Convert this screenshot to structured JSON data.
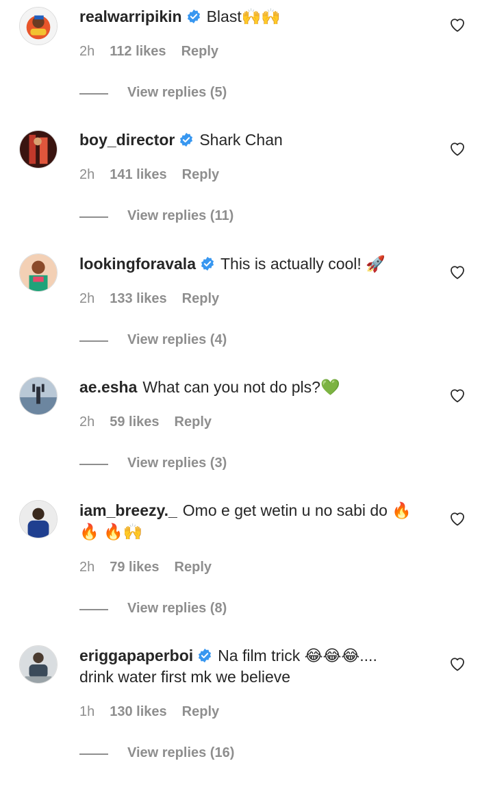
{
  "colors": {
    "verified": "#3897f0",
    "muted": "#8e8e8e",
    "text": "#262626"
  },
  "comments": [
    {
      "username": "realwarripikin",
      "verified": true,
      "text": "Blast🙌🙌",
      "continuation": "",
      "time": "2h",
      "likes": "112 likes",
      "reply": "Reply",
      "view_replies": "View replies (5)",
      "avatar_icon": "avatar-icon"
    },
    {
      "username": "boy_director",
      "verified": true,
      "text": "Shark Chan",
      "continuation": "",
      "time": "2h",
      "likes": "141 likes",
      "reply": "Reply",
      "view_replies": "View replies (11)",
      "avatar_icon": "avatar-icon"
    },
    {
      "username": "lookingforavala",
      "verified": true,
      "text": "This is actually cool! 🚀",
      "continuation": "",
      "time": "2h",
      "likes": "133 likes",
      "reply": "Reply",
      "view_replies": "View replies (4)",
      "avatar_icon": "avatar-icon"
    },
    {
      "username": "ae.esha",
      "verified": false,
      "text": "What can you not do pls?💚",
      "continuation": "",
      "time": "2h",
      "likes": "59 likes",
      "reply": "Reply",
      "view_replies": "View replies (3)",
      "avatar_icon": "avatar-icon"
    },
    {
      "username": "iam_breezy._",
      "verified": false,
      "text": "Omo e get wetin u no sabi do 🔥",
      "continuation": "🔥 🔥🙌",
      "time": "2h",
      "likes": "79 likes",
      "reply": "Reply",
      "view_replies": "View replies (8)",
      "avatar_icon": "avatar-icon"
    },
    {
      "username": "eriggapaperboi",
      "verified": true,
      "text": "Na film trick 😂😂😂....",
      "continuation": "drink water first mk we believe",
      "time": "1h",
      "likes": "130 likes",
      "reply": "Reply",
      "view_replies": "View replies (16)",
      "avatar_icon": "avatar-icon"
    }
  ]
}
